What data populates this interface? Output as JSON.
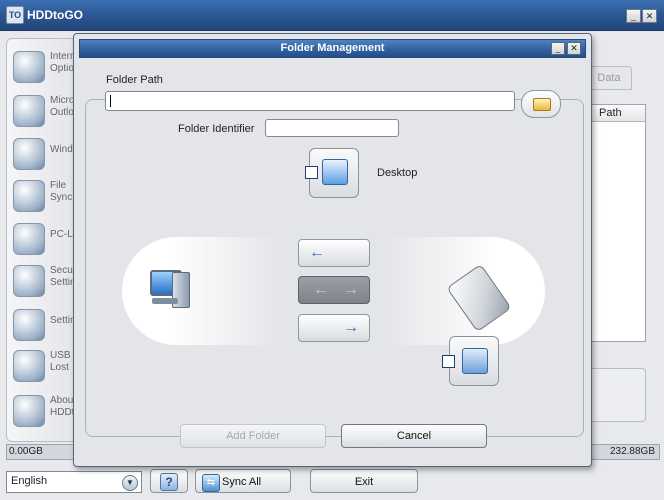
{
  "app": {
    "title": "HDDtoGO",
    "icon_text": "TO"
  },
  "sidebar": {
    "items": [
      {
        "label": "Intern\nOptio",
        "icon": "internet-icon"
      },
      {
        "label": "Micro\nOutlo",
        "icon": "outlook-icon"
      },
      {
        "label": "Windo",
        "icon": "windows-icon"
      },
      {
        "label": "File\nSync",
        "icon": "file-sync-icon"
      },
      {
        "label": "PC-L",
        "icon": "pc-lock-icon"
      },
      {
        "label": "Secu\nSettin",
        "icon": "security-icon"
      },
      {
        "label": "Settin",
        "icon": "settings-icon"
      },
      {
        "label": "USB\nLost",
        "icon": "usb-lost-icon"
      },
      {
        "label": "Abou\nHDDt",
        "icon": "about-icon"
      }
    ]
  },
  "right": {
    "tab_label": "Data",
    "path_header": "Path"
  },
  "status": {
    "left": "0.00GB",
    "right": "232.88GB"
  },
  "bottom": {
    "language": "English",
    "help_label": "?",
    "sync_all_label": "Sync All",
    "exit_label": "Exit"
  },
  "dialog": {
    "title": "Folder Management",
    "folder_path_label": "Folder Path",
    "folder_path_value": "",
    "folder_identifier_label": "Folder Identifier",
    "folder_identifier_value": "",
    "desktop_label": "Desktop",
    "desktop_checked": false,
    "portable_checked": false,
    "arrows": {
      "to_pc": "←",
      "both": "←→",
      "to_drive": "→"
    },
    "add_folder_label": "Add Folder",
    "cancel_label": "Cancel"
  }
}
